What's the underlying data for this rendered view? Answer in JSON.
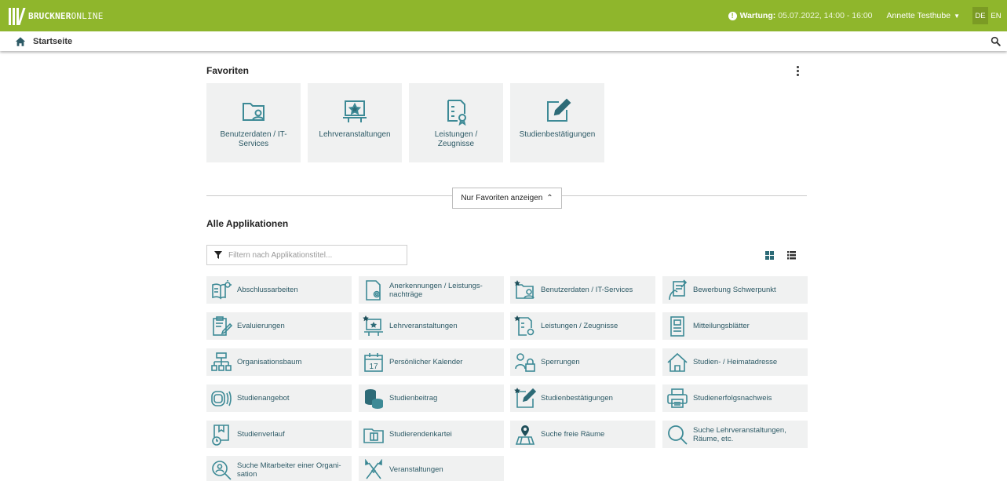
{
  "topbar": {
    "brand_bold": "BRUCKNER",
    "brand_light": "ONLINE",
    "maintenance_label": "Wartung:",
    "maintenance_value": "05.07.2022, 14:00 - 16:00",
    "user_name": "Annette Testhube",
    "lang_de": "DE",
    "lang_en": "EN",
    "accent_color": "#8fb62c"
  },
  "nav": {
    "breadcrumb": "Startseite"
  },
  "favorites": {
    "title": "Favoriten",
    "items": [
      {
        "label": "Benutzerdaten / IT-Services",
        "icon": "user-folder-icon"
      },
      {
        "label": "Lehrveranstaltungen",
        "icon": "lecture-board-icon"
      },
      {
        "label": "Leistungen / Zeugnisse",
        "icon": "certificate-list-icon"
      },
      {
        "label": "Studienbestätigungen",
        "icon": "edit-document-icon"
      }
    ]
  },
  "toggle_button": "Nur Favoriten anzeigen",
  "all_apps": {
    "title": "Alle Applikationen",
    "filter_placeholder": "Filtern nach Applikationstitel...",
    "items": [
      {
        "label": "Abschlussarbeiten",
        "icon": "thesis-icon"
      },
      {
        "label": "Anerkennungen / Leistungs-nachträge",
        "icon": "recognition-icon"
      },
      {
        "label": "Benutzerdaten / IT-Services",
        "icon": "user-folder-icon"
      },
      {
        "label": "Bewerbung Schwerpunkt",
        "icon": "application-icon"
      },
      {
        "label": "Evaluierungen",
        "icon": "evaluation-icon"
      },
      {
        "label": "Lehrveranstaltungen",
        "icon": "lecture-board-icon"
      },
      {
        "label": "Leistungen / Zeugnisse",
        "icon": "certificate-list-icon"
      },
      {
        "label": "Mitteilungsblätter",
        "icon": "newsletter-icon"
      },
      {
        "label": "Organisationsbaum",
        "icon": "org-tree-icon"
      },
      {
        "label": "Persönlicher Kalender",
        "icon": "calendar-icon"
      },
      {
        "label": "Sperrungen",
        "icon": "lock-user-icon"
      },
      {
        "label": "Studien- / Heimatadresse",
        "icon": "home-address-icon"
      },
      {
        "label": "Studienangebot",
        "icon": "study-offer-icon"
      },
      {
        "label": "Studienbeitrag",
        "icon": "fee-coins-icon"
      },
      {
        "label": "Studienbestätigungen",
        "icon": "edit-document-icon"
      },
      {
        "label": "Studienerfolgsnachweis",
        "icon": "printer-icon"
      },
      {
        "label": "Studienverlauf",
        "icon": "study-progress-icon"
      },
      {
        "label": "Studierendenkartei",
        "icon": "card-file-icon"
      },
      {
        "label": "Suche freie Räume",
        "icon": "room-search-icon"
      },
      {
        "label": "Suche Lehrveranstaltungen, Räume, etc.",
        "icon": "magnifier-icon"
      },
      {
        "label": "Suche Mitarbeiter einer Organi-sation",
        "icon": "staff-search-icon"
      },
      {
        "label": "Veranstaltungen",
        "icon": "events-icon"
      }
    ]
  }
}
